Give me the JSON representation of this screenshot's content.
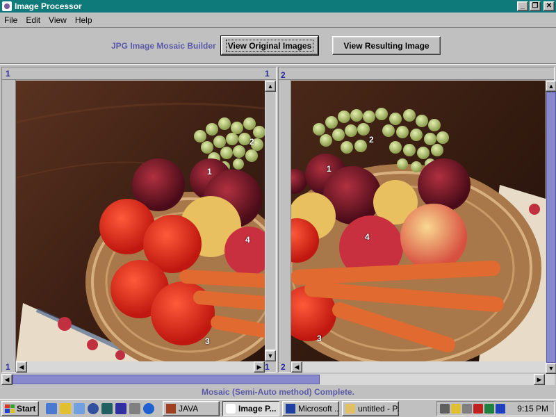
{
  "window": {
    "title": "Image Processor",
    "buttons": [
      "_",
      "❐",
      "✕"
    ]
  },
  "menu": [
    {
      "label": "File"
    },
    {
      "label": "Edit"
    },
    {
      "label": "View"
    },
    {
      "label": "Help"
    }
  ],
  "toolbar": {
    "label": "JPG Image Mosaic Builder",
    "view_original": "View Original Images",
    "view_resulting": "View Resulting Image"
  },
  "left_panel": {
    "ruler_top_left": "1",
    "ruler_top_right": "1",
    "ruler_bottom_left": "1",
    "ruler_bottom_right": "1",
    "markers": [
      "1",
      "2",
      "4",
      "3"
    ]
  },
  "right_panel": {
    "ruler_top_left": "2",
    "ruler_bottom_left": "2",
    "markers": [
      "1",
      "2",
      "4",
      "3"
    ]
  },
  "status": "Mosaic (Semi-Auto method) Complete.",
  "taskbar": {
    "start": "Start",
    "tasks": [
      {
        "label": "JAVA",
        "active": false
      },
      {
        "label": "Image P...",
        "active": true
      },
      {
        "label": "Microsoft ...",
        "active": false
      },
      {
        "label": "untitled - P...",
        "active": false
      }
    ],
    "clock": "9:15 PM"
  },
  "colors": {
    "titlebar": "#0f7a7a",
    "accent_text": "#5a5aa8",
    "ruler_text": "#2a2a9a",
    "scroll_thumb": "#8888cc"
  }
}
